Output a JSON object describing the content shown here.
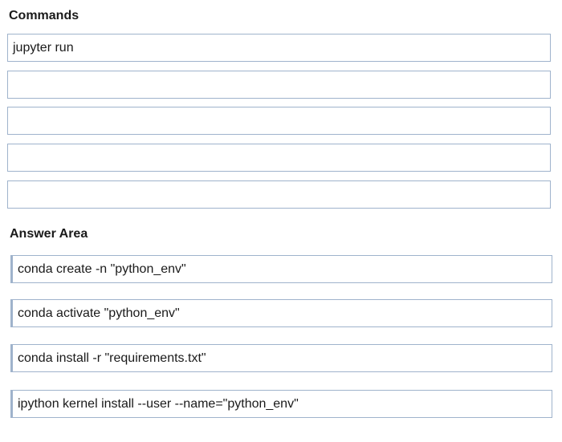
{
  "commands": {
    "heading": "Commands",
    "slots": [
      "jupyter run",
      "",
      "",
      "",
      ""
    ]
  },
  "answer_area": {
    "heading": "Answer Area",
    "items": [
      "conda create -n \"python_env\"",
      "conda activate \"python_env\"",
      "conda install -r \"requirements.txt\"",
      "ipython kernel install --user --name=\"python_env\""
    ]
  }
}
